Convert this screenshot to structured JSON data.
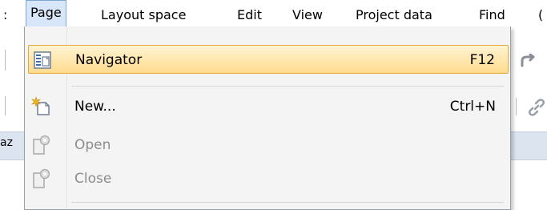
{
  "menubar": {
    "items": [
      {
        "label": ":"
      },
      {
        "label": "Page"
      },
      {
        "label": "Layout space"
      },
      {
        "label": "Edit"
      },
      {
        "label": "View"
      },
      {
        "label": "Project data"
      },
      {
        "label": "Find"
      },
      {
        "label": "("
      }
    ]
  },
  "background": {
    "panel_text": "az"
  },
  "page_menu": {
    "items": [
      {
        "label": "Navigator",
        "shortcut": "F12",
        "icon": "navigator-icon",
        "state": "highlighted"
      },
      {
        "label": "New...",
        "shortcut": "Ctrl+N",
        "icon": "new-page-icon",
        "state": "enabled"
      },
      {
        "label": "Open",
        "shortcut": "",
        "icon": "open-page-icon",
        "state": "disabled"
      },
      {
        "label": "Close",
        "shortcut": "",
        "icon": "close-page-icon",
        "state": "disabled"
      }
    ]
  },
  "colors": {
    "highlight_top": "#fff4d2",
    "highlight_bottom": "#ffdb8e",
    "highlight_border": "#e5a935",
    "open_menu_bg": "#d7e6f8",
    "disabled_text": "#8c8c8c"
  }
}
